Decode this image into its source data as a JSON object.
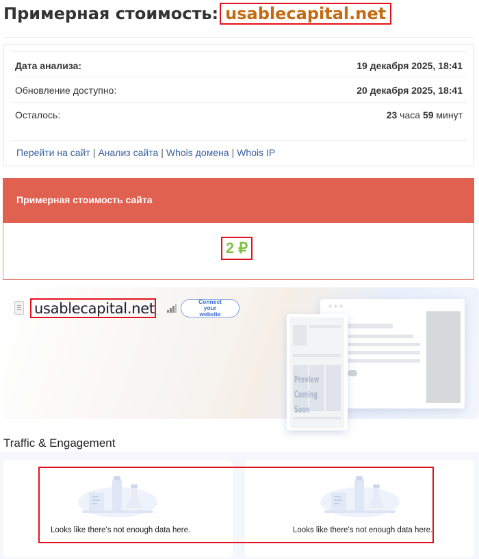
{
  "header": {
    "title_prefix": "Примерная стоимость:",
    "domain": "usablecapital.net"
  },
  "info": {
    "rows": [
      {
        "label": "Дата анализа:",
        "value": "19 декабря 2025, 18:41"
      },
      {
        "label": "Обновление доступно:",
        "value": "20 декабря 2025, 18:41"
      },
      {
        "label": "Осталось:",
        "hours": "23",
        "hours_unit": "часа",
        "minutes": "59",
        "minutes_unit": "минут"
      }
    ],
    "links": [
      "Перейти на сайт",
      "Анализ сайта",
      "Whois домена",
      "Whois IP"
    ]
  },
  "cost": {
    "heading": "Примерная стоимость сайта",
    "price": "2 ₽"
  },
  "banner": {
    "site_name": "usablecapital.net",
    "connect_button": "Connect your website",
    "preview_text": "Preview Coming Soon"
  },
  "traffic": {
    "title": "Traffic & Engagement",
    "cards": [
      {
        "message": "Looks like there's not enough data here."
      },
      {
        "message": "Looks like there's not enough data here."
      }
    ]
  },
  "colors": {
    "accent_red": "#e06150",
    "price_green": "#7cc242",
    "domain_orange": "#c46b12",
    "link_blue": "#3a5fa0",
    "highlight_red": "#e3101a"
  }
}
